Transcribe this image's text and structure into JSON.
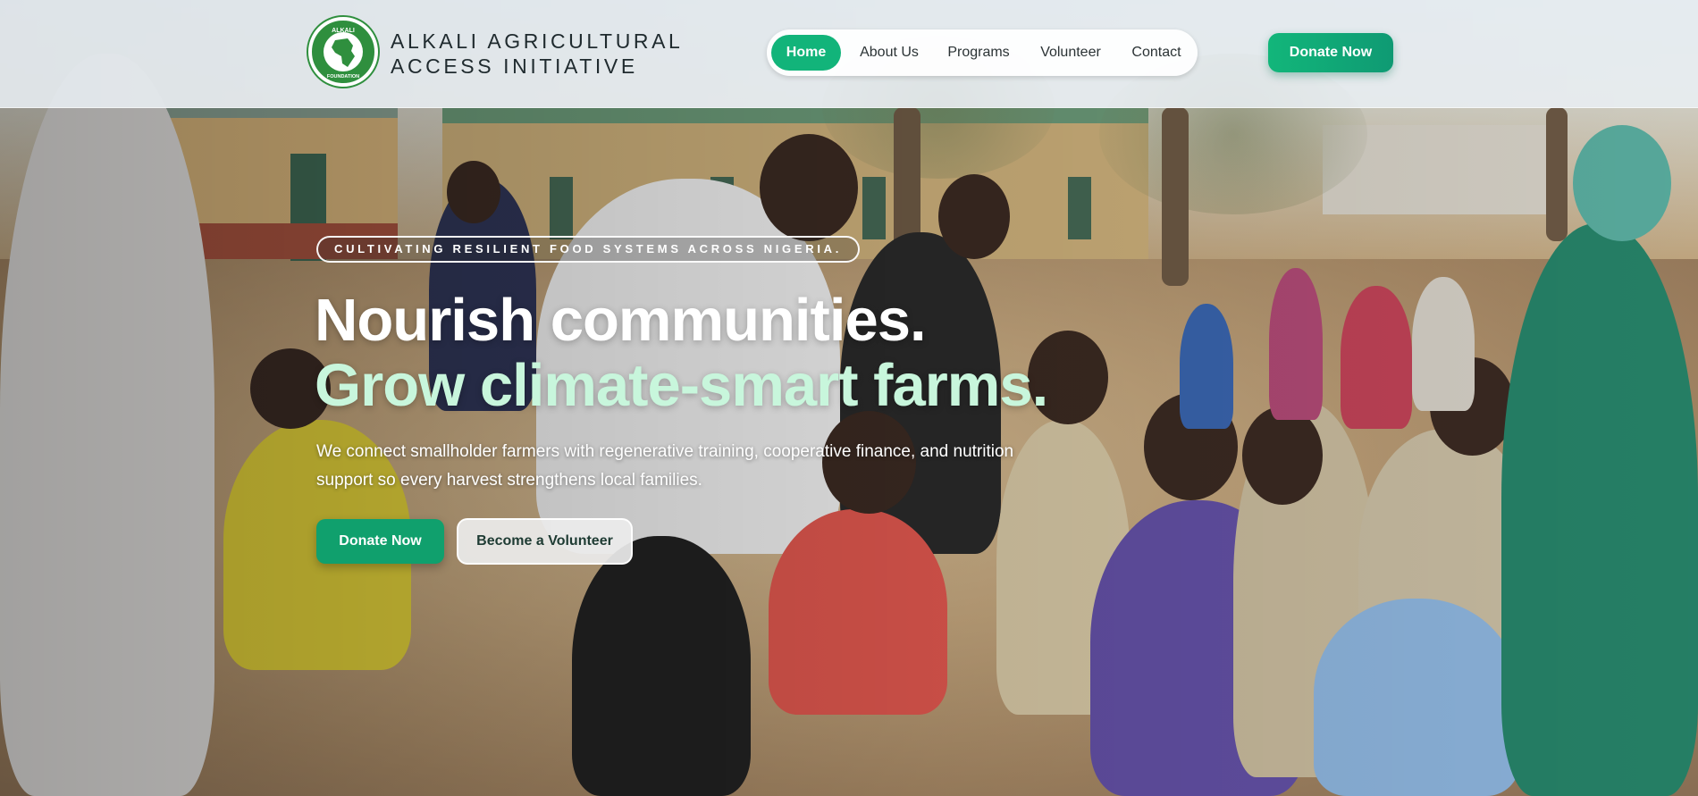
{
  "brand": {
    "line1": "ALKALI AGRICULTURAL",
    "line2": "ACCESS INITIATIVE",
    "logo_text_top": "ALKALI",
    "logo_text_bottom": "FOUNDATION",
    "logo_icon": "africa-map-icon"
  },
  "nav": {
    "items": [
      {
        "label": "Home",
        "active": true
      },
      {
        "label": "About Us",
        "active": false
      },
      {
        "label": "Programs",
        "active": false
      },
      {
        "label": "Volunteer",
        "active": false
      },
      {
        "label": "Contact",
        "active": false
      }
    ],
    "donate_label": "Donate Now"
  },
  "hero": {
    "tagline": "CULTIVATING RESILIENT FOOD SYSTEMS ACROSS NIGERIA.",
    "headline_1": "Nourish communities.",
    "headline_2": "Grow climate-smart farms.",
    "subtitle": "We connect smallholder farmers with regenerative training, cooperative finance, and nutrition support so every harvest strengthens local families.",
    "primary_cta": "Donate Now",
    "secondary_cta": "Become a Volunteer"
  },
  "colors": {
    "accent": "#12b47a",
    "accent_dark": "#10a06d",
    "headline_highlight": "#c8f6dc"
  }
}
